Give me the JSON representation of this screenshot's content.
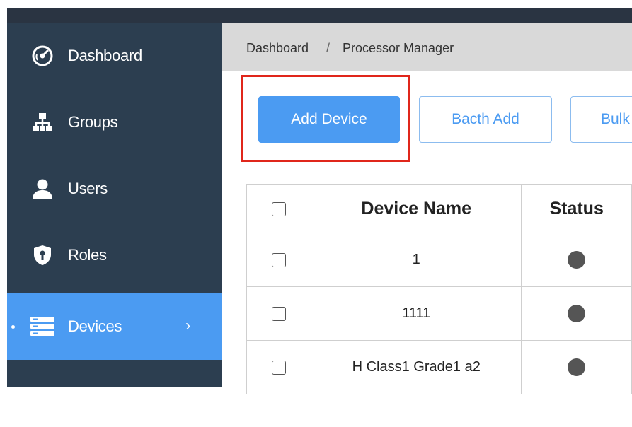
{
  "sidebar": {
    "items": [
      {
        "label": "Dashboard",
        "icon": "dashboard-icon"
      },
      {
        "label": "Groups",
        "icon": "groups-icon"
      },
      {
        "label": "Users",
        "icon": "user-icon"
      },
      {
        "label": "Roles",
        "icon": "shield-icon"
      },
      {
        "label": "Devices",
        "icon": "server-icon",
        "active": true
      }
    ]
  },
  "breadcrumb": {
    "root": "Dashboard",
    "separator": "/",
    "current": "Processor Manager"
  },
  "toolbar": {
    "add_label": "Add Device",
    "batch_label": "Bacth Add",
    "bulk_label": "Bulk"
  },
  "table": {
    "headers": [
      "Device Name",
      "Status"
    ],
    "rows": [
      {
        "name": "1",
        "status": "offline"
      },
      {
        "name": "1111",
        "status": "offline"
      },
      {
        "name": "H Class1 Grade1 a2",
        "status": "offline"
      }
    ]
  },
  "colors": {
    "sidebar_bg": "#2c3e50",
    "accent": "#4b9bf2",
    "highlight": "#e0261b",
    "breadcrumb_bg": "#d9d9d9"
  }
}
